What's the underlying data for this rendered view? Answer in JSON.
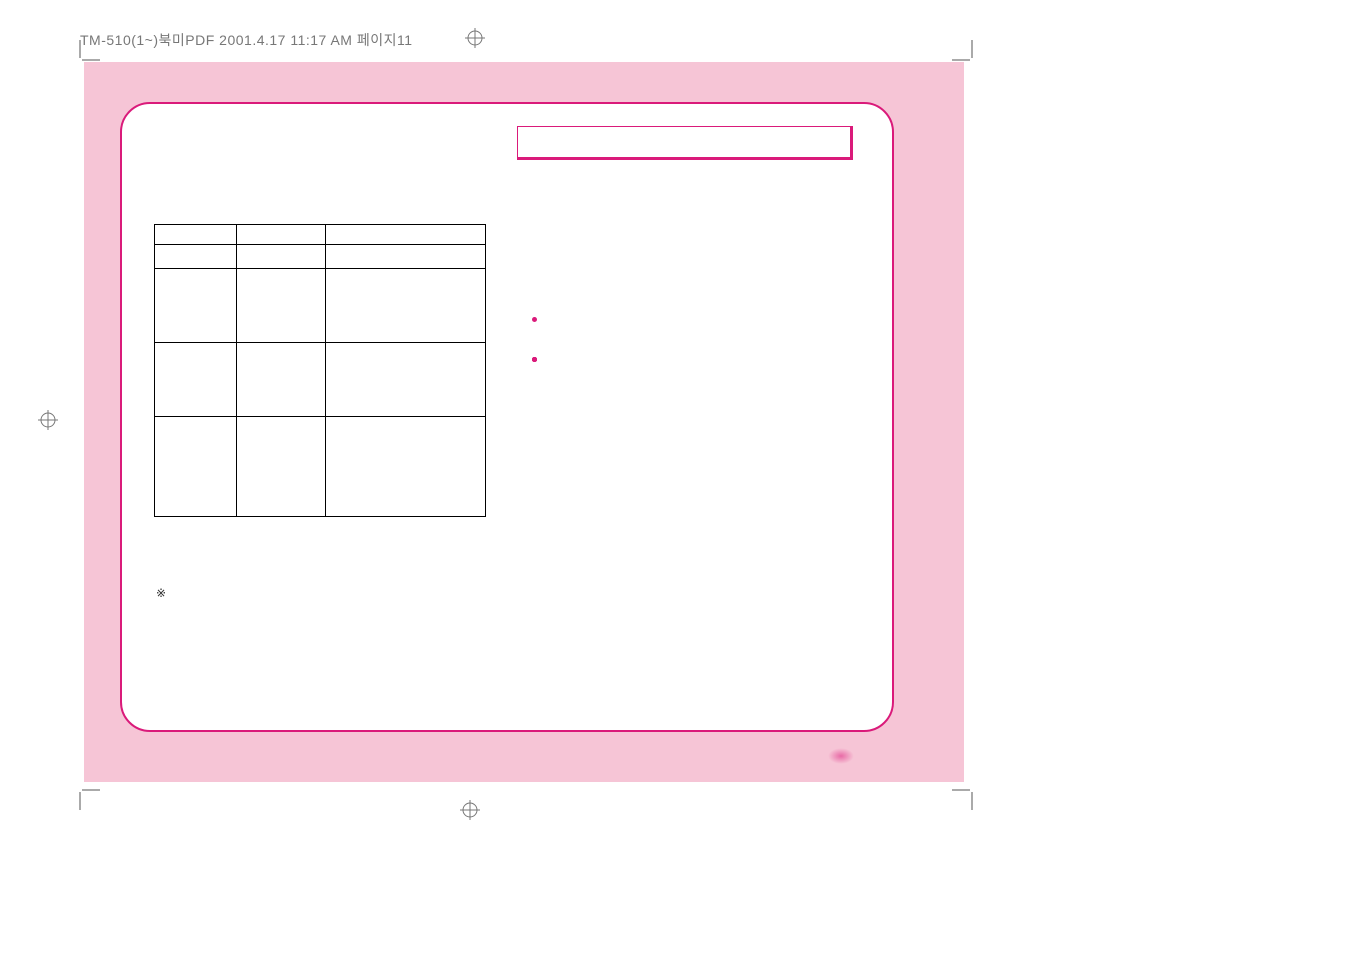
{
  "header_text": "TM-510(1~)북미PDF 2001.4.17 11:17 AM 페이지11",
  "title_box": "",
  "table_note_symbol": "※",
  "table": {
    "rows": [
      [
        "",
        "",
        ""
      ],
      [
        "",
        "",
        ""
      ],
      [
        "",
        "",
        ""
      ],
      [
        "",
        "",
        ""
      ],
      [
        "",
        "",
        ""
      ]
    ]
  },
  "bullets": [
    "",
    "",
    "",
    "",
    "",
    "",
    "",
    ""
  ]
}
